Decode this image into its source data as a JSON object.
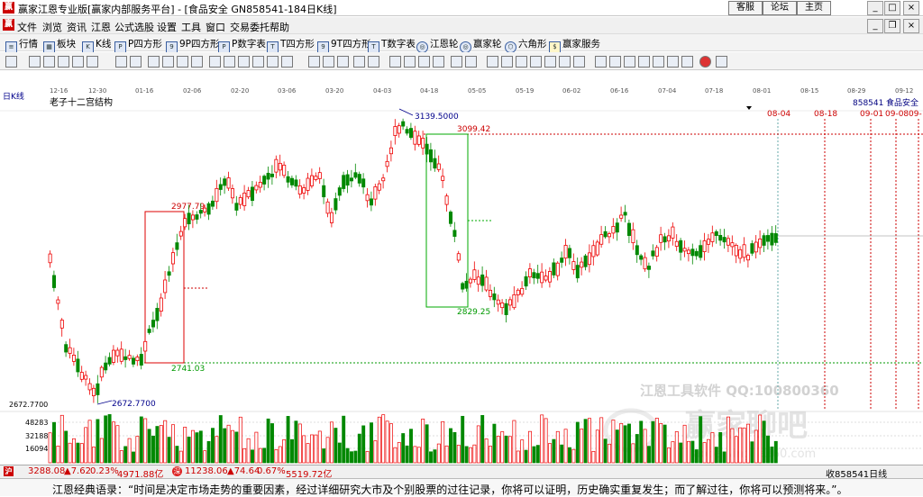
{
  "window": {
    "title": "赢家江恩专业版[赢家内部服务平台] - [食品安全  GN858541-184日K线]",
    "top_buttons": [
      "客服",
      "论坛",
      "主页"
    ]
  },
  "menu": [
    "文件",
    "浏览",
    "资讯",
    "江恩",
    "公式选股",
    "设置",
    "工具",
    "窗口",
    "交易委托",
    "帮助"
  ],
  "toolbar": [
    "行情",
    "板块",
    "K线",
    "P四方形",
    "9P四方形",
    "P数字表",
    "T四方形",
    "9T四方形",
    "T数字表",
    "江恩轮",
    "赢家轮",
    "六角形",
    "赢家服务"
  ],
  "time_axis": [
    "12-16",
    "12-30",
    "01-16",
    "02-06",
    "02-20",
    "03-06",
    "03-20",
    "04-03",
    "04-18",
    "05-05",
    "05-19",
    "06-02",
    "06-16",
    "07-04",
    "07-18",
    "08-01",
    "08-15",
    "08-29",
    "09-12"
  ],
  "chart": {
    "period_label": "日K线",
    "indicator": "老子十二宫结构",
    "code": "858541",
    "name": "食品安全",
    "future_dates": [
      "08-04",
      "08-18",
      "09-01",
      "09-08",
      "09-"
    ],
    "left_price_label": "2672.7700",
    "annotations": {
      "low": "2672.7700",
      "high": "3139.5000",
      "level_3099": "3099.42",
      "level_2977": "2977.79",
      "level_2741": "2741.03",
      "level_2829": "2829.25"
    },
    "volume_ticks": [
      "48283",
      "32188",
      "16094"
    ],
    "watermark_line1": "江恩工具软件  QQ:100800360",
    "watermark_line2": "赢家聊吧",
    "watermark_line3": "liaoba.yingjia360.com"
  },
  "status": {
    "index1": "3288.08",
    "index1_change": "▲7.62",
    "index1_pct": "0.23%",
    "index1_amount": "4971.88亿",
    "index2": "11238.06",
    "index2_change": "▲74.64",
    "index2_pct": "0.67%",
    "index2_amount": "5519.72亿",
    "right": "收858541日线"
  },
  "quote": "江恩经典语录：“时间是决定市场走势的重要因素，经过详细研究大市及个别股票的过往记录，你将可以证明，历史确实重复发生；而了解过往，你将可以预测将来。”。"
}
